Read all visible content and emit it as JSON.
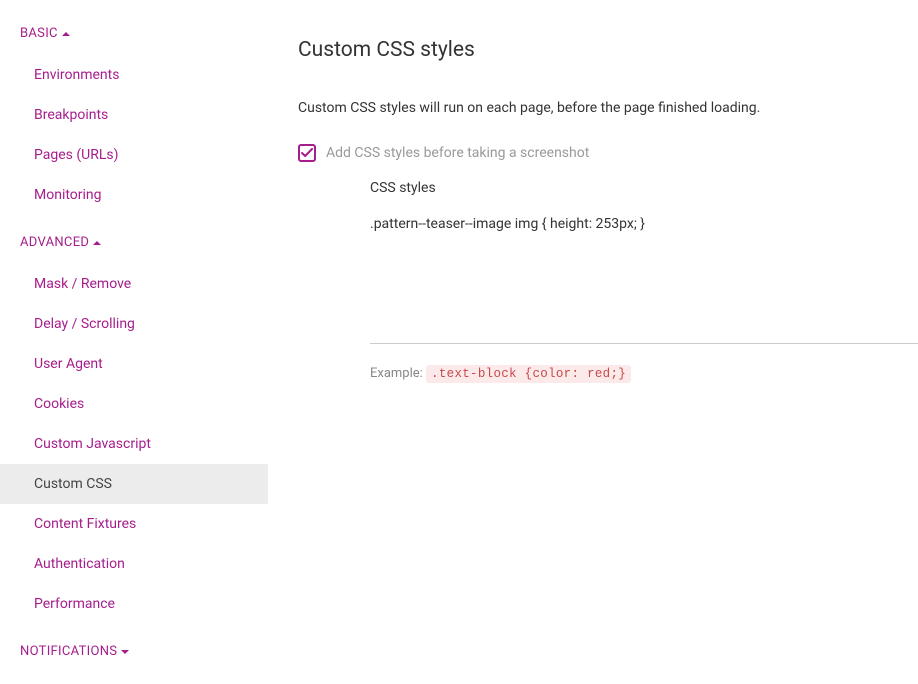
{
  "sidebar": {
    "sections": {
      "basic": {
        "label": "BASIC",
        "items": [
          {
            "label": "Environments"
          },
          {
            "label": "Breakpoints"
          },
          {
            "label": "Pages (URLs)"
          },
          {
            "label": "Monitoring"
          }
        ]
      },
      "advanced": {
        "label": "ADVANCED",
        "items": [
          {
            "label": "Mask / Remove"
          },
          {
            "label": "Delay / Scrolling"
          },
          {
            "label": "User Agent"
          },
          {
            "label": "Cookies"
          },
          {
            "label": "Custom Javascript"
          },
          {
            "label": "Custom CSS"
          },
          {
            "label": "Content Fixtures"
          },
          {
            "label": "Authentication"
          },
          {
            "label": "Performance"
          }
        ]
      },
      "notifications": {
        "label": "NOTIFICATIONS"
      }
    }
  },
  "main": {
    "title": "Custom CSS styles",
    "description": "Custom CSS styles will run on each page, before the page finished loading.",
    "checkbox_label": "Add CSS styles before taking a screenshot",
    "field_label": "CSS styles",
    "css_value": ".pattern--teaser--image img { height: 253px; }",
    "example_prefix": "Example: ",
    "example_code": ".text-block {color: red;}"
  }
}
